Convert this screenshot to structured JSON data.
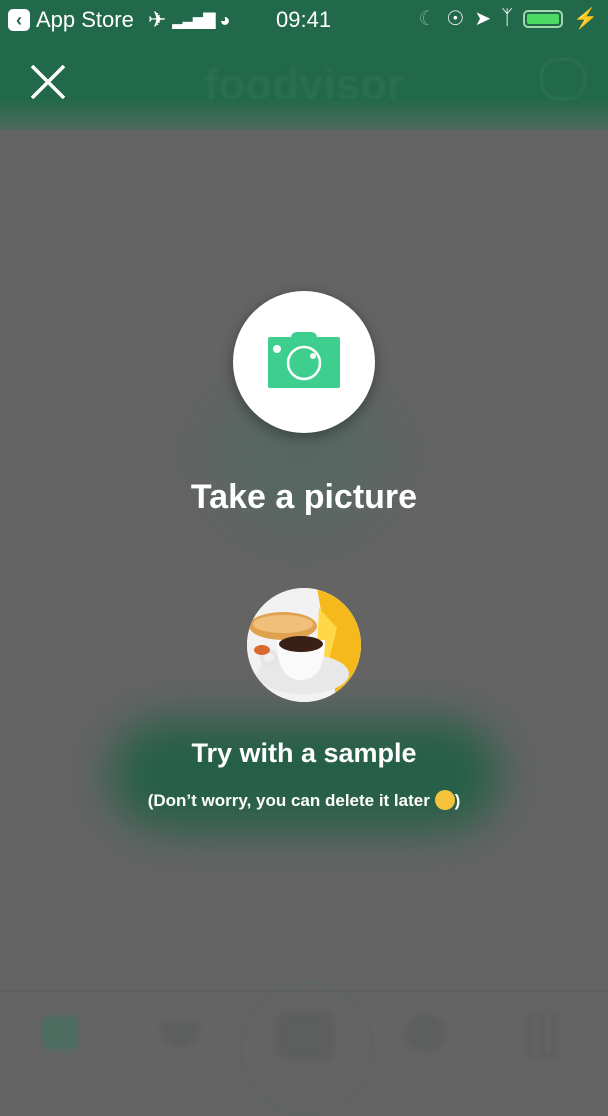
{
  "status_bar": {
    "back_app": "App Store",
    "time": "09:41",
    "icons": [
      "airplane-icon",
      "signal-icon",
      "wifi-icon",
      "moon-icon",
      "rotation-lock-icon",
      "location-icon",
      "bluetooth-icon",
      "battery-icon",
      "charging-icon"
    ],
    "battery_level_percent": 100
  },
  "header": {
    "brand": "foodvisor",
    "close_icon": "close-icon",
    "chat_icon": "chat-icon"
  },
  "colors": {
    "accent_green": "#3ecf8e",
    "header_green": "#22684a",
    "overlay": "#646464"
  },
  "modal": {
    "take_picture_label": "Take a picture",
    "sample_label": "Try with a sample",
    "sample_note": "(Don’t worry, you can delete it later",
    "sample_note_end": ")"
  }
}
